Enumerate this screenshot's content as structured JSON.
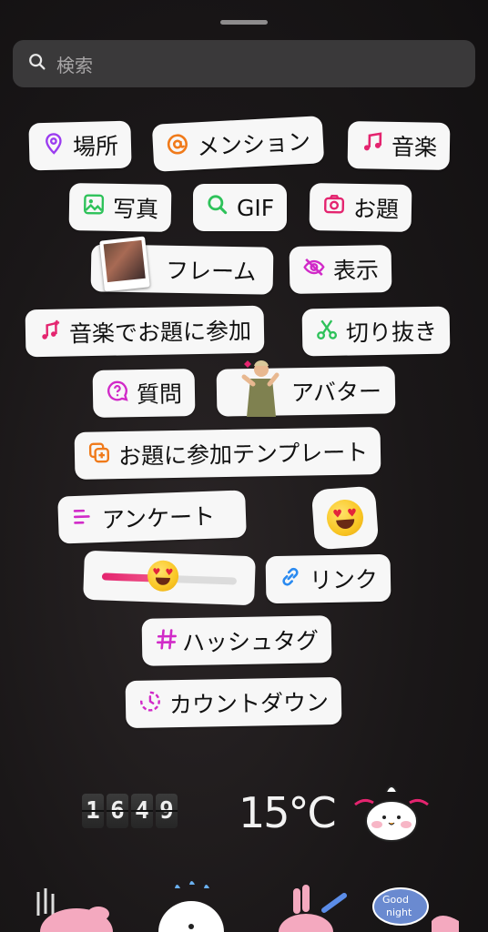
{
  "search": {
    "placeholder": "検索"
  },
  "stickers": {
    "location": "場所",
    "mention": "メンション",
    "music": "音楽",
    "photo": "写真",
    "gif": "GIF",
    "add_yours": "お題",
    "frame": "フレーム",
    "reveal": "表示",
    "add_yours_music": "音楽でお題に参加",
    "cutout": "切り抜き",
    "questions": "質問",
    "avatar": "アバター",
    "add_yours_template": "お題に参加テンプレート",
    "poll": "アンケート",
    "link": "リンク",
    "hashtag": "ハッシュタグ",
    "countdown": "カウントダウン"
  },
  "emoji_slider": {
    "value": 0.45
  },
  "widgets": {
    "clock_digits": [
      "1",
      "6",
      "4",
      "9"
    ],
    "temperature": "15°C"
  },
  "colors": {
    "background": "#1a1718",
    "chip": "#f7f7f7",
    "purple": "#9b3cf0",
    "orange": "#f07a1a",
    "pink": "#e4246f",
    "green": "#2ec25a",
    "magenta": "#d12ac8",
    "blue": "#2a8af0"
  }
}
